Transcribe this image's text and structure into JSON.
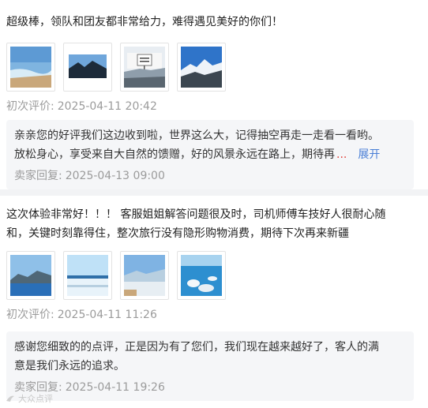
{
  "reviews": [
    {
      "text": "超级棒，领队和团友都非常给力，难得遇见美好的你们！",
      "photo_count": 4,
      "label": "初次评价:",
      "time": "2025-04-11 20:42",
      "reply": {
        "text_line1": "亲亲您的好评我们这边收到啦，世界这么大，记得抽空再走一走看一看哟。",
        "text_line2": "放松身心，享受来自大自然的馈赠，好的风景永远在路上，期待再",
        "ellipsis": "...",
        "expand": "展开",
        "label": "卖家回复:",
        "time": "2025-04-13 09:00"
      }
    },
    {
      "text_line1": "这次体验非常好！！！ 客服姐姐解答问题很及时，司机师傅车技好人很耐心随",
      "text_line2": "和，关键时刻靠得住，整次旅行没有隐形购物消费，期待下次再来新疆",
      "photo_count": 4,
      "label": "初次评价:",
      "time": "2025-04-11 11:26",
      "reply": {
        "text_line1": "感谢您细致的的点评，正是因为有了您们，我们现在越来越好了，客人的满",
        "text_line2": "意是我们永远的追求。",
        "label": "卖家回复:",
        "time": "2025-04-11 19:26"
      }
    }
  ],
  "watermark": "大众点评"
}
